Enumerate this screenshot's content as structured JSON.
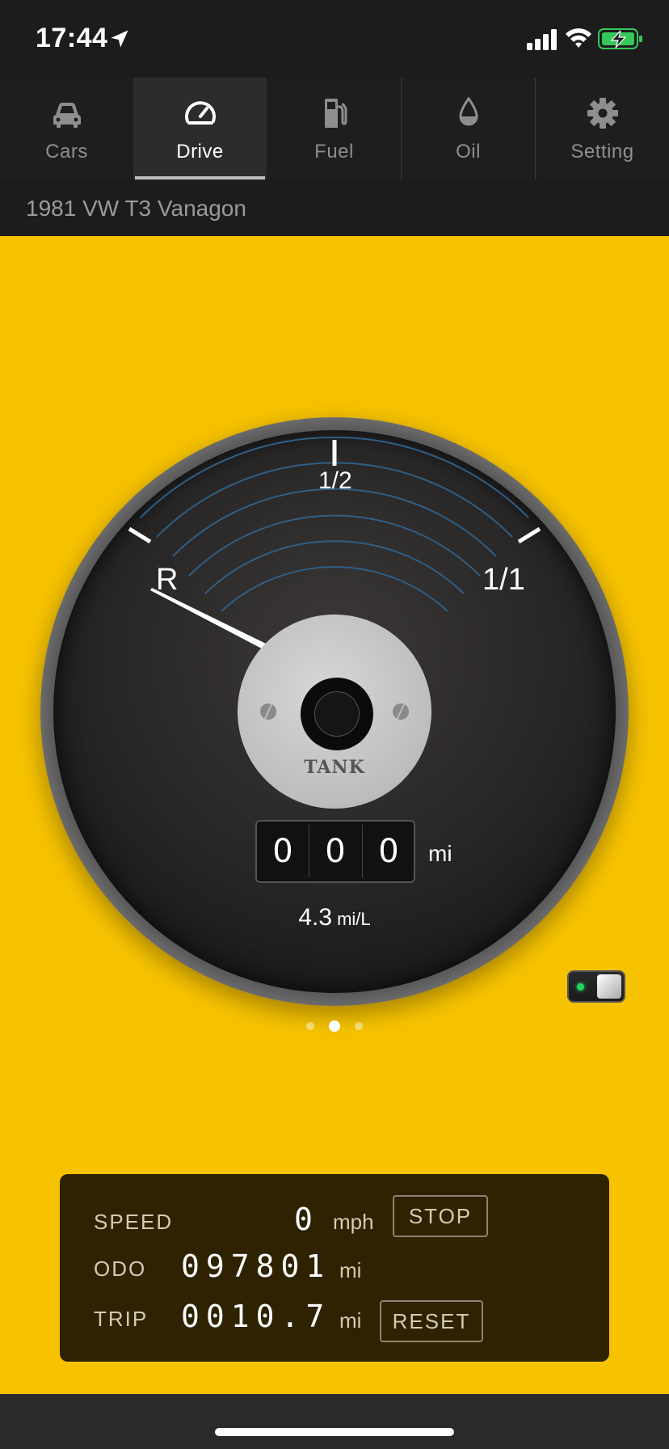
{
  "status": {
    "time": "17:44",
    "icons": [
      "location-arrow-icon",
      "signal-icon",
      "wifi-icon",
      "battery-charging-icon"
    ],
    "battery_color": "#34c759"
  },
  "tabs": [
    {
      "label": "Cars",
      "icon": "car-icon",
      "active": false
    },
    {
      "label": "Drive",
      "icon": "speedometer-icon",
      "active": true
    },
    {
      "label": "Fuel",
      "icon": "fuel-pump-icon",
      "active": false
    },
    {
      "label": "Oil",
      "icon": "oil-drop-icon",
      "active": false
    },
    {
      "label": "Setting",
      "icon": "gear-icon",
      "active": false
    }
  ],
  "car": {
    "name": "1981 VW T3 Vanagon"
  },
  "gauge": {
    "mark_reserve": "R",
    "mark_half": "1/2",
    "mark_full": "1/1",
    "hub_label": "TANK",
    "odometer_digits": [
      "0",
      "0",
      "0"
    ],
    "odometer_unit": "mi",
    "efficiency_value": "4.3",
    "efficiency_unit": "mi/L",
    "needle_level": 0,
    "background_color": "#f7c300"
  },
  "pager": {
    "count": 3,
    "active_index": 1
  },
  "toggle": {
    "on": true
  },
  "panel": {
    "speed_label": "SPEED",
    "speed_value": "0",
    "speed_unit": "mph",
    "stop_button": "STOP",
    "odo_label": "ODO",
    "odo_value": "097801",
    "odo_unit": "mi",
    "trip_label": "TRIP",
    "trip_value": "0010.7",
    "trip_unit": "mi",
    "reset_button": "RESET"
  }
}
